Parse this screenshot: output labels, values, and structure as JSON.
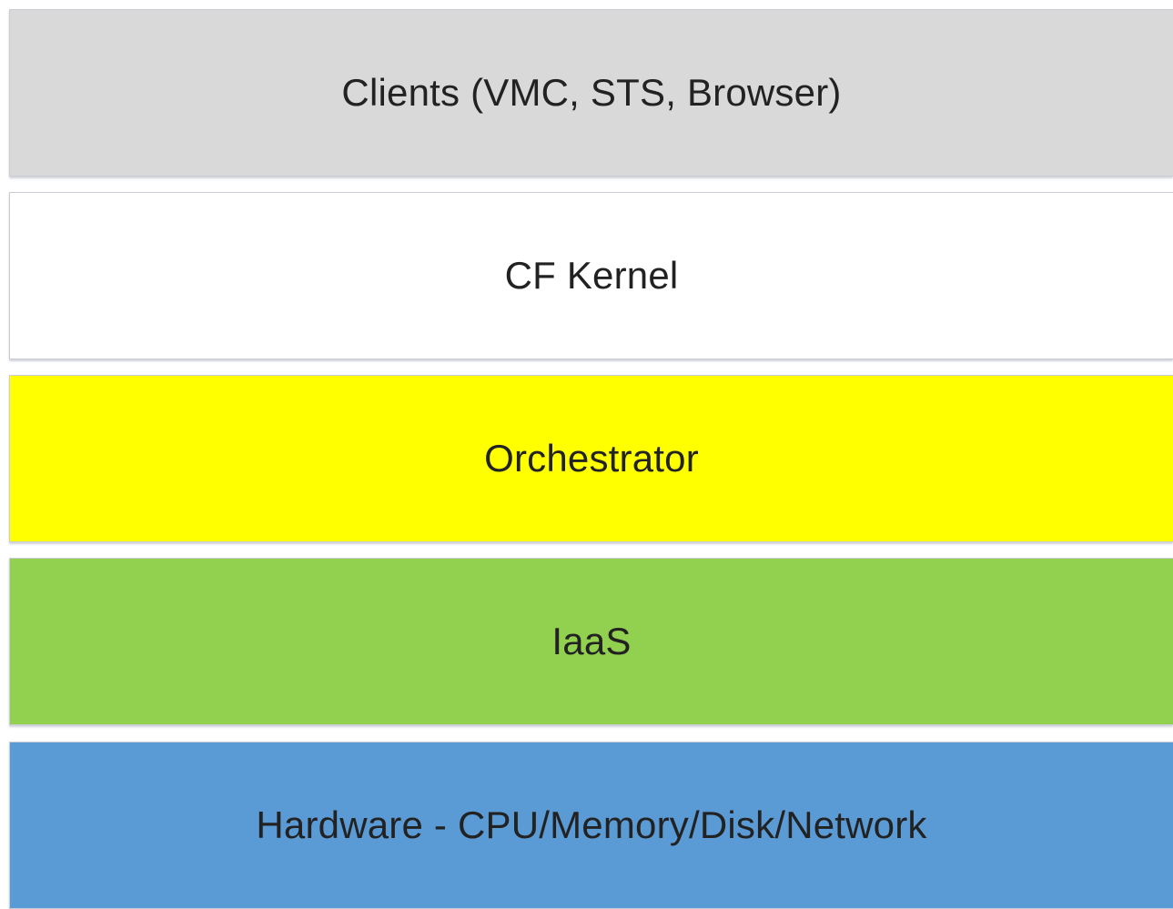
{
  "layers": [
    {
      "label": "Clients (VMC, STS, Browser)",
      "color": "#d9d9d9"
    },
    {
      "label": "CF Kernel",
      "color": "#ffffff"
    },
    {
      "label": "Orchestrator",
      "color": "#ffff00"
    },
    {
      "label": "IaaS",
      "color": "#92d050"
    },
    {
      "label": "Hardware - CPU/Memory/Disk/Network",
      "color": "#5b9bd5"
    }
  ]
}
